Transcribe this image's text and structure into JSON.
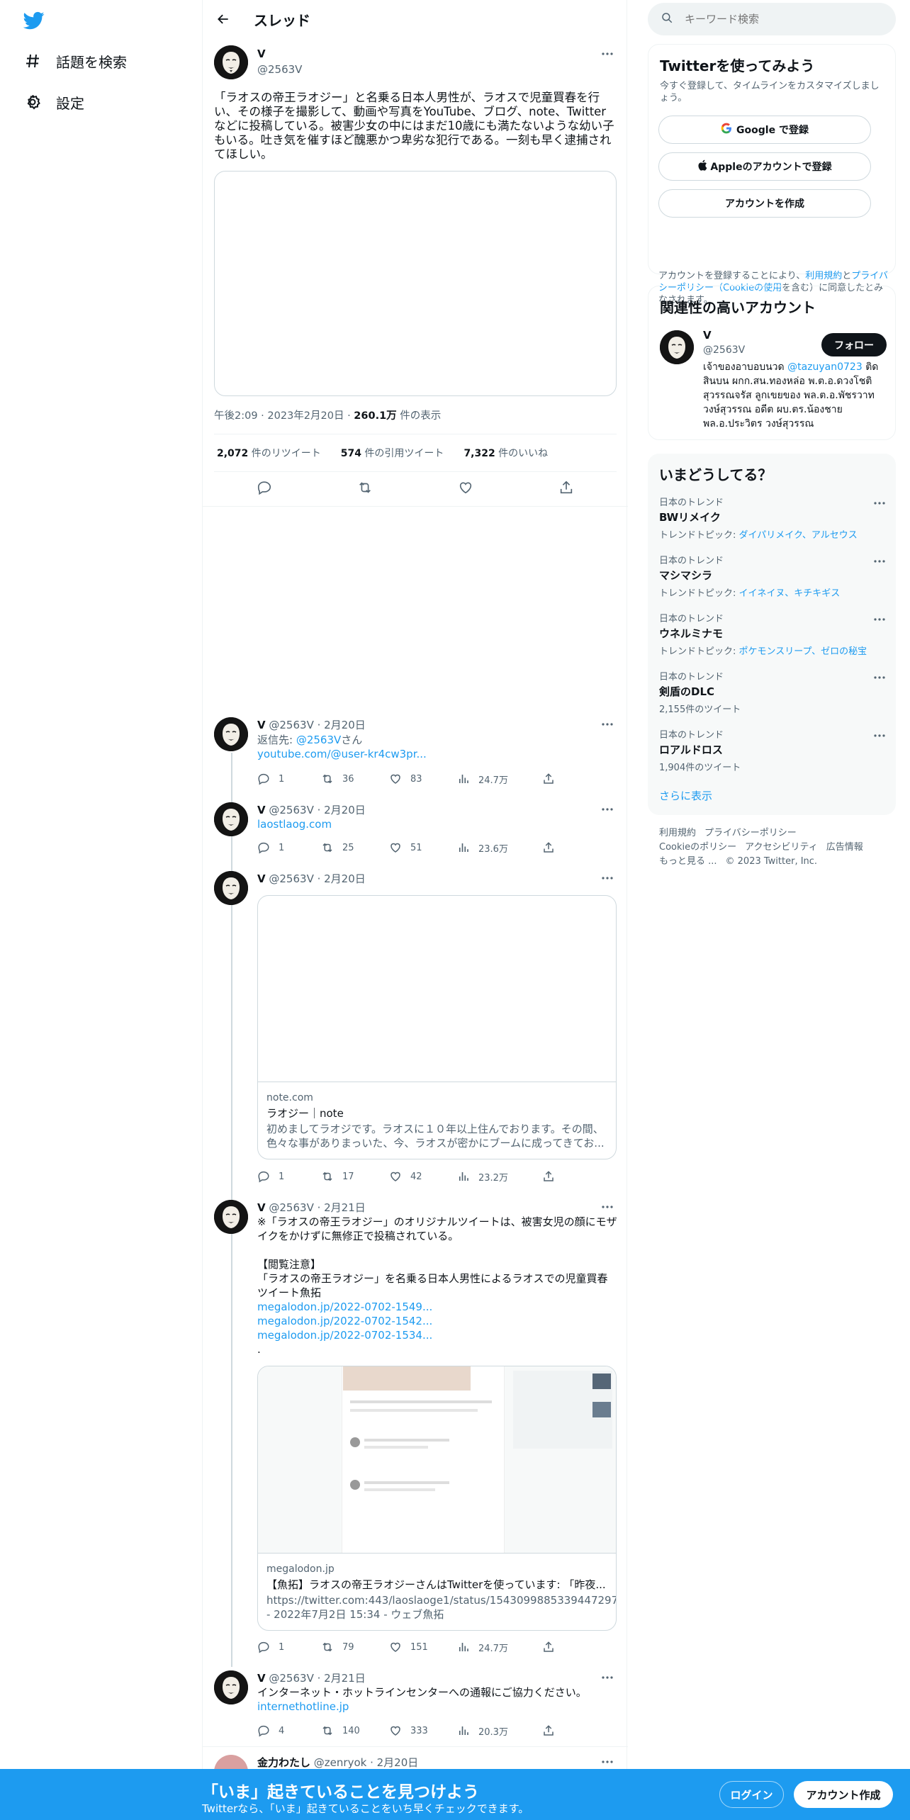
{
  "nav": {
    "explore": "話題を検索",
    "settings": "設定"
  },
  "header": {
    "title": "スレッド"
  },
  "main_tweet": {
    "name": "V",
    "handle": "@2563V",
    "text": "「ラオスの帝王ラオジー」と名乗る日本人男性が、ラオスで児童買春を行い、その様子を撮影して、動画や写真をYouTube、ブログ、note、Twitterなどに投稿している。被害少女の中にはまだ10歳にも満たないような幼い子もいる。吐き気を催すほど醜悪かつ卑劣な犯行である。一刻も早く逮捕されてほしい。",
    "time": "午後2:09 · 2023年2月20日 · ",
    "views": "260.1万",
    "views_label": " 件の表示",
    "retweets": "2,072",
    "retweets_label": " 件のリツイート",
    "quotes": "574",
    "quotes_label": " 件の引用ツイート",
    "likes": "7,322",
    "likes_label": " 件のいいね"
  },
  "replies": [
    {
      "name": "V",
      "meta": "@2563V · 2月20日",
      "reply_prefix": "返信先: ",
      "reply_to": "@2563V",
      "reply_suffix": "さん",
      "link": "youtube.com/@user-kr4cw3pr...",
      "replies": "1",
      "retweets": "36",
      "likes": "83",
      "views": "24.7万"
    },
    {
      "name": "V",
      "meta": "@2563V · 2月20日",
      "link": "laostlaog.com",
      "replies": "1",
      "retweets": "25",
      "likes": "51",
      "views": "23.6万"
    },
    {
      "name": "V",
      "meta": "@2563V · 2月20日",
      "card_domain": "note.com",
      "card_title": "ラオジー｜note",
      "card_desc": "初めましてラオジです。ラオスに１０年以上住んでおります。その間、色々な事がありまっいた、今、ラオスが密かにブームに成ってきてお...",
      "replies": "1",
      "retweets": "17",
      "likes": "42",
      "views": "23.2万"
    },
    {
      "name": "V",
      "meta": "@2563V · 2月21日",
      "text": "※「ラオスの帝王ラオジー」のオリジナルツイートは、被害女児の顔にモザイクをかけずに無修正で投稿されている。\n\n【閲覧注意】\n「ラオスの帝王ラオジー」を名乗る日本人男性によるラオスでの児童買春ツイート魚拓",
      "links": [
        "megalodon.jp/2022-0702-1549...",
        "megalodon.jp/2022-0702-1542...",
        "megalodon.jp/2022-0702-1534..."
      ],
      "trailing": ".",
      "card_domain": "megalodon.jp",
      "card_title": "【魚拓】ラオスの帝王ラオジーさんはTwitterを使っています: 「昨夜...",
      "card_desc": "https://twitter.com:443/laoslaoge1/status/1543099885339447297 - 2022年7月2日 15:34 - ウェブ魚拓",
      "replies": "1",
      "retweets": "79",
      "likes": "151",
      "views": "24.7万"
    },
    {
      "name": "V",
      "meta": "@2563V · 2月21日",
      "text": "インターネット・ホットラインセンターへの通報にご協力ください。",
      "link": "internethotline.jp",
      "replies": "4",
      "retweets": "140",
      "likes": "333",
      "views": "20.3万"
    },
    {
      "name": "金力わたし",
      "meta": "@zenryok · 2月20日"
    }
  ],
  "right": {
    "search_placeholder": "キーワード検索",
    "signup": {
      "title": "Twitterを使ってみよう",
      "sub": "今すぐ登録して、タイムラインをカスタマイズしましょう。",
      "google": "Google で登録",
      "apple": "Appleのアカウントで登録",
      "create": "アカウントを作成",
      "terms_1": "アカウントを登録することにより、",
      "terms_link1": "利用規約",
      "terms_2": "と",
      "terms_link2": "プライバシーポリシー（Cookieの使用",
      "terms_3": "を含む）に同意したとみなされます。"
    },
    "related": {
      "title": "関連性の高いアカウント",
      "name": "V",
      "handle": "@2563V",
      "follow": "フォロー",
      "bio_1": "เจ้าของอาบอบนวด ",
      "bio_link": "@tazuyan0723",
      "bio_2": " ติดสินบน ผกก.สน.ทองหล่อ พ.ต.อ.ดวงโชติ สุวรรณจรัส ลูกเขยของ พล.ต.อ.พัชรวาท วงษ์สุวรรณ อดีต ผบ.ตร.น้องชาย พล.อ.ประวิตร วงษ์สุวรรณ"
    },
    "trends": {
      "title": "いまどうしてる？",
      "items": [
        {
          "cat": "日本のトレンド",
          "name": "BWリメイク",
          "sub_prefix": "トレンドトピック: ",
          "sub_links": "ダイパリメイク、アルセウス"
        },
        {
          "cat": "日本のトレンド",
          "name": "マシマシラ",
          "sub_prefix": "トレンドトピック: ",
          "sub_links": "イイネイヌ、キチキギス"
        },
        {
          "cat": "日本のトレンド",
          "name": "ウネルミナモ",
          "sub_prefix": "トレンドトピック: ",
          "sub_links": "ポケモンスリープ、ゼロの秘宝"
        },
        {
          "cat": "日本のトレンド",
          "name": "剣盾のDLC",
          "sub": "2,155件のツイート"
        },
        {
          "cat": "日本のトレンド",
          "name": "ロアルドロス",
          "sub": "1,904件のツイート"
        }
      ],
      "more": "さらに表示"
    },
    "footer": {
      "l1": "利用規約",
      "l2": "プライバシーポリシー",
      "l3": "Cookieのポリシー",
      "l4": "アクセシビリティ",
      "l5": "広告情報",
      "l6": "もっと見る ...",
      "copyright": "© 2023 Twitter, Inc."
    }
  },
  "bottom": {
    "headline": "「いま」起きていることを見つけよう",
    "sub": "Twitterなら、「いま」起きていることをいち早くチェックできます。",
    "login": "ログイン",
    "signup": "アカウント作成"
  },
  "colors": {
    "accent": "#1d9bf0",
    "text": "#0f1419",
    "muted": "#536471",
    "border": "#eff3f4"
  }
}
